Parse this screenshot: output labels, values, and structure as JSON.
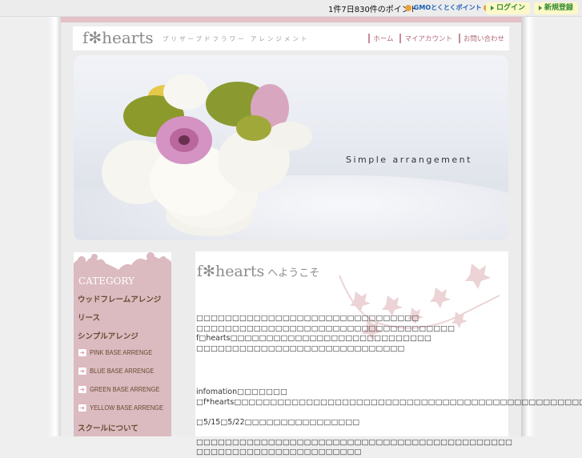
{
  "topbar": {
    "count_text": "1件7日830件のポイント",
    "gmo_label": "GMOとくとくポイント",
    "login_label": "ログイン",
    "register_label": "新規登録"
  },
  "header": {
    "logo": "f✻hearts",
    "tagline": "プリザーブドフラワー アレンジメント",
    "nav": [
      "ホーム",
      "マイアカウント",
      "お問い合わせ"
    ]
  },
  "hero": {
    "caption": "Simple arrangement"
  },
  "sidebar": {
    "title": "CATEGORY",
    "items": [
      {
        "label": "ウッドフレームアレンジ",
        "type": "main"
      },
      {
        "label": "リース",
        "type": "main"
      },
      {
        "label": "シンプルアレンジ",
        "type": "main"
      },
      {
        "label": "PINK BASE ARRENGE",
        "type": "sub"
      },
      {
        "label": "BLUE BASE ARRENGE",
        "type": "sub"
      },
      {
        "label": "GREEN BASE ARRENGE",
        "type": "sub"
      },
      {
        "label": "YELLOW BASE ARRENGE",
        "type": "sub"
      },
      {
        "label": "スクールについて",
        "type": "main"
      }
    ],
    "arrow_glyph": "➜"
  },
  "main": {
    "welcome_title": "f✻hearts",
    "welcome_sub": "へようこそ",
    "intro_lines": [
      "□□□□□□□□□□□□□□□□□□□□□□□□□□□□□□□",
      "□□□□□□□□□□□□□□□□□□□□□□□□□□□□□□□□□□□□",
      "f□hearts□□□□□□□□□□□□□□□□□□□□□□□□□□□□",
      "□□□□□□□□□□□□□□□□□□□□□□□□□□□□□"
    ],
    "info_lines": [
      "infomation□□□□□□□",
      "□f*hearts□□□□□□□□□□□□□□□□□□□□□□□□□□□□□□□□□□□□□□□□□□□□□□□□□□□□□□□",
      "",
      "□5/15□5/22□□□□□□□□□□□□□□□□",
      "",
      "□□□□□□□□□□□□□□□□□□□□□□□□□□□□□□□□□□□□□□□□□□□□",
      "□□□□□□□□□□□□□□□□□□□□□□□"
    ]
  },
  "colors": {
    "pink_strip": "#e3c1c6",
    "sidebar_bg": "#dbbac0",
    "nav_text": "#b06a78",
    "sidebar_text": "#6a4a30",
    "button_bg": "#fdf8c8",
    "button_text": "#2e8a2e"
  }
}
